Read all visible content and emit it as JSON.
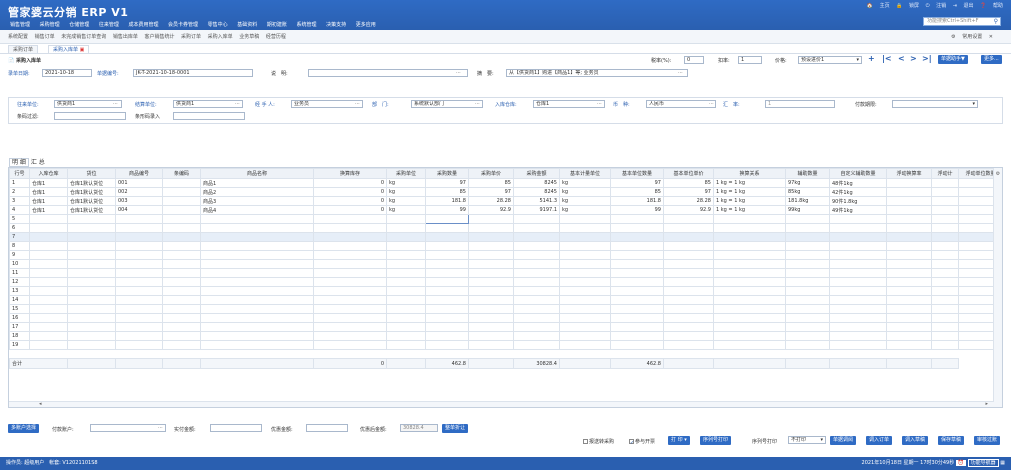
{
  "app": {
    "title": "管家婆云分销 ERP V1"
  },
  "top_right": {
    "home": "主页",
    "lock": "锁屏",
    "logout": "注销",
    "exit": "退出",
    "help": "帮助"
  },
  "search": {
    "placeholder": "功能搜索Ctrl+Shift+F"
  },
  "menu": [
    "销售管理",
    "采购管理",
    "仓储管理",
    "往来管理",
    "成本费用管理",
    "会员卡券管理",
    "零售中心",
    "基础资料",
    "期初建账",
    "系统管理",
    "决策支持",
    "更多应用"
  ],
  "subnav": {
    "items": [
      "系统配置",
      "销售订单",
      "未完成销售订单查询",
      "销售出库单",
      "客户销售统计",
      "采购订单",
      "采购入库单",
      "业务草稿",
      "经营历程"
    ],
    "settings": "常用设置"
  },
  "tabs": [
    {
      "label": "采购订单"
    },
    {
      "label": "采购入库单"
    }
  ],
  "doc": {
    "title": "采购入库单",
    "tax_label": "税率(%):",
    "tax_value": "0",
    "discount_label": "扣率:",
    "discount_value": "1",
    "price_label": "价格:",
    "price_value": "预设进价1",
    "help_btn": "单据助手▼",
    "more_btn": "更多...",
    "date_label": "录单日期:",
    "date_value": "2021-10-18",
    "no_label": "单据编号:",
    "no_value": "JK-T-2021-10-18-0001",
    "desc_label": "说　明:",
    "desc_value": "",
    "summary_label": "摘　要:",
    "summary_value": "从【供货商1】购进【商品1】等; 业务员"
  },
  "form": {
    "supplier_label": "往来单位:",
    "supplier_value": "供货商1",
    "settle_label": "结算单位:",
    "settle_value": "供货商1",
    "handler_label": "经 手 人:",
    "handler_value": "业务员",
    "dept_label": "部　门:",
    "dept_value": "系统默认部门",
    "warehouse_label": "入库仓库:",
    "warehouse_value": "仓库1",
    "currency_label": "币　种:",
    "currency_value": "人民币",
    "rate_label": "汇　率:",
    "rate_value": "1",
    "payterm_label": "付款期限:",
    "payterm_value": "",
    "barcode_label": "条码过滤:",
    "barcode_entry_label": "条形码录入"
  },
  "grid_tabs": [
    "明 细",
    "汇 总"
  ],
  "columns": [
    "行号",
    "入库仓库",
    "货位",
    "商品编号",
    "条编码",
    "商品名称",
    "换算库存",
    "采购单位",
    "采购数量",
    "采购单价",
    "采购金额",
    "基本计量单位",
    "基本单位数量",
    "基本单位单价",
    "换算关系",
    "辅助数量",
    "自定义辅助数量",
    "浮动换算率",
    "浮动计",
    "浮动单位数量"
  ],
  "rows": [
    {
      "no": "1",
      "wh": "仓库1",
      "loc": "仓库1默认货位",
      "code": "001",
      "bar": "",
      "name": "商品1",
      "stock": "0",
      "unit": "kg",
      "qty": "97",
      "price": "85",
      "amt": "8245",
      "bunit": "kg",
      "bqty": "97",
      "bprice": "85",
      "conv": "1 kg = 1 kg",
      "aux": "97kg",
      "caux": "48件1kg"
    },
    {
      "no": "2",
      "wh": "仓库1",
      "loc": "仓库1默认货位",
      "code": "002",
      "bar": "",
      "name": "商品2",
      "stock": "0",
      "unit": "kg",
      "qty": "85",
      "price": "97",
      "amt": "8245",
      "bunit": "kg",
      "bqty": "85",
      "bprice": "97",
      "conv": "1 kg = 1 kg",
      "aux": "85kg",
      "caux": "42件1kg"
    },
    {
      "no": "3",
      "wh": "仓库1",
      "loc": "仓库1默认货位",
      "code": "003",
      "bar": "",
      "name": "商品3",
      "stock": "0",
      "unit": "kg",
      "qty": "181.8",
      "price": "28.28",
      "amt": "5141.3",
      "bunit": "kg",
      "bqty": "181.8",
      "bprice": "28.28",
      "conv": "1 kg = 1 kg",
      "aux": "181.8kg",
      "caux": "90件1.8kg"
    },
    {
      "no": "4",
      "wh": "仓库1",
      "loc": "仓库1默认货位",
      "code": "004",
      "bar": "",
      "name": "商品4",
      "stock": "0",
      "unit": "kg",
      "qty": "99",
      "price": "92.9",
      "amt": "9197.1",
      "bunit": "kg",
      "bqty": "99",
      "bprice": "92.9",
      "conv": "1 kg = 1 kg",
      "aux": "99kg",
      "caux": "49件1kg"
    }
  ],
  "empty_rows": [
    "5",
    "6",
    "7",
    "8",
    "9",
    "10",
    "11",
    "12",
    "13",
    "14",
    "15",
    "16",
    "17",
    "18",
    "19"
  ],
  "totals": {
    "label": "合计",
    "stock": "0",
    "qty": "462.8",
    "amt": "30828.4",
    "bqty": "462.8"
  },
  "bottom": {
    "multi_btn": "多账户选择",
    "account_label": "付款账户:",
    "paid_label": "实付金额:",
    "discount_amt_label": "优惠金额:",
    "after_label": "优惠后金额:",
    "after_value": "30828.4",
    "whole_btn": "整单折让",
    "opt_purchase": "报送转采购",
    "opt_join": "参与开票",
    "print_btn": "打 印",
    "seq_print_btn": "序列号打印",
    "seq_print_label": "序列号打印",
    "seq_print_value": "不打印",
    "actions": [
      "单据调阅",
      "调入订单",
      "调入草稿",
      "保存草稿",
      "审核过账"
    ]
  },
  "status": {
    "operator": "操作员: 超级用户",
    "account": "帐套: V12021101S8",
    "datetime": "2021年10月18日 星期一 17时30分49秒",
    "btn": "功能导航器"
  }
}
